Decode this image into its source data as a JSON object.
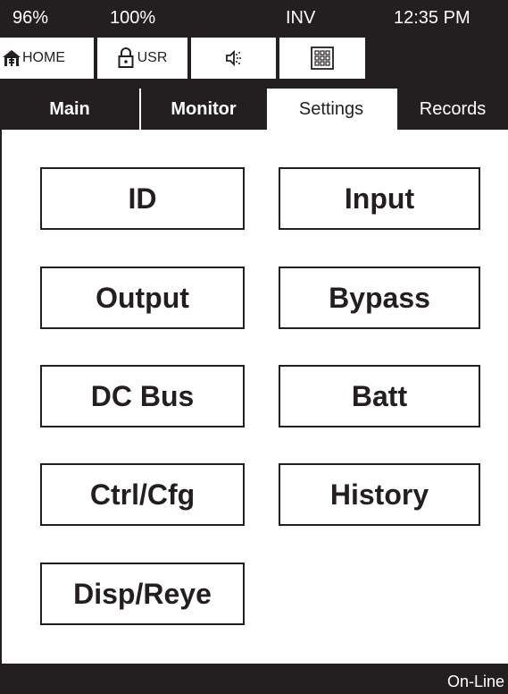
{
  "status_bar": {
    "battery": "96%",
    "load": "100%",
    "mode": "INV",
    "time": "12:35 PM"
  },
  "quick_buttons": {
    "home": {
      "label": "HOME",
      "icon": "home-icon"
    },
    "user": {
      "label": "USR",
      "icon": "lock-icon"
    },
    "sound": {
      "icon": "speaker-icon"
    },
    "keypad": {
      "icon": "keypad-icon"
    }
  },
  "tabs": [
    {
      "label": "Main",
      "active": false
    },
    {
      "label": "Monitor",
      "active": false
    },
    {
      "label": "Settings",
      "active": true
    },
    {
      "label": "Records",
      "active": false
    }
  ],
  "settings_buttons": [
    {
      "label": "ID"
    },
    {
      "label": "Input"
    },
    {
      "label": "Output"
    },
    {
      "label": "Bypass"
    },
    {
      "label": "DC Bus"
    },
    {
      "label": "Batt"
    },
    {
      "label": "Ctrl/Cfg"
    },
    {
      "label": "History"
    },
    {
      "label": "Disp/Reye"
    }
  ],
  "footer": {
    "status": "On-Line"
  },
  "colors": {
    "dark": "#231f20",
    "light": "#ffffff"
  }
}
